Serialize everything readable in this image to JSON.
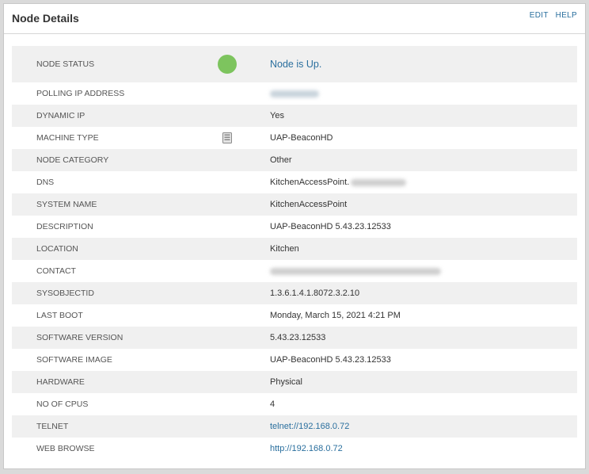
{
  "panel": {
    "title": "Node Details",
    "edit_label": "EDIT",
    "help_label": "HELP"
  },
  "rows": [
    {
      "label": "NODE STATUS",
      "value": "Node is Up.",
      "status_color": "#7dc45e"
    },
    {
      "label": "POLLING IP ADDRESS",
      "value": ""
    },
    {
      "label": "DYNAMIC IP",
      "value": "Yes"
    },
    {
      "label": "MACHINE TYPE",
      "value": "UAP-BeaconHD",
      "icon": "server-icon"
    },
    {
      "label": "NODE CATEGORY",
      "value": "Other"
    },
    {
      "label": "DNS",
      "value": "KitchenAccessPoint."
    },
    {
      "label": "SYSTEM NAME",
      "value": "KitchenAccessPoint"
    },
    {
      "label": "DESCRIPTION",
      "value": "UAP-BeaconHD 5.43.23.12533"
    },
    {
      "label": "LOCATION",
      "value": "Kitchen"
    },
    {
      "label": "CONTACT",
      "value": ""
    },
    {
      "label": "SYSOBJECTID",
      "value": "1.3.6.1.4.1.8072.3.2.10"
    },
    {
      "label": "LAST BOOT",
      "value": "Monday, March 15, 2021 4:21 PM"
    },
    {
      "label": "SOFTWARE VERSION",
      "value": "5.43.23.12533"
    },
    {
      "label": "SOFTWARE IMAGE",
      "value": "UAP-BeaconHD 5.43.23.12533"
    },
    {
      "label": "HARDWARE",
      "value": "Physical"
    },
    {
      "label": "NO OF CPUS",
      "value": "4"
    },
    {
      "label": "TELNET",
      "value": "telnet://192.168.0.72"
    },
    {
      "label": "WEB BROWSE",
      "value": "http://192.168.0.72"
    }
  ]
}
